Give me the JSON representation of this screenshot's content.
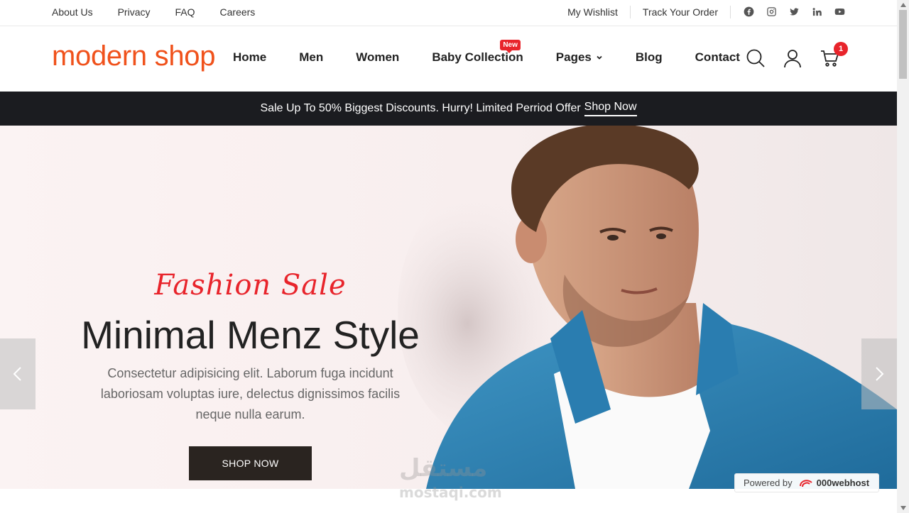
{
  "topbar": {
    "left_links": [
      "About Us",
      "Privacy",
      "FAQ",
      "Careers"
    ],
    "wishlist": "My Wishlist",
    "track_order": "Track Your Order",
    "social_icons": [
      "facebook-icon",
      "instagram-icon",
      "twitter-icon",
      "linkedin-icon",
      "youtube-icon"
    ]
  },
  "header": {
    "logo": "modern shop",
    "logo_color": "#f0521c",
    "nav": [
      "Home",
      "Men",
      "Women",
      "Baby Collection",
      "Pages",
      "Blog",
      "Contact"
    ],
    "new_badge": "New",
    "cart_count": "1",
    "header_icons": [
      "search-icon",
      "user-icon",
      "cart-icon"
    ]
  },
  "promo": {
    "text": "Sale Up To 50% Biggest Discounts. Hurry! Limited Perriod Offer",
    "link": "Shop Now"
  },
  "hero": {
    "script": "Fashion Sale",
    "title": "Minimal Menz Style",
    "description": "Consectetur adipisicing elit. Laborum fuga incidunt laboriosam voluptas iure, delectus dignissimos facilis neque nulla earum.",
    "button": "SHOP NOW",
    "accent_color": "#e8242b"
  },
  "watermark": {
    "arabic": "مستقل",
    "latin": "mostaqi.com"
  },
  "powered": {
    "label": "Powered by",
    "brand": "000webhost"
  }
}
